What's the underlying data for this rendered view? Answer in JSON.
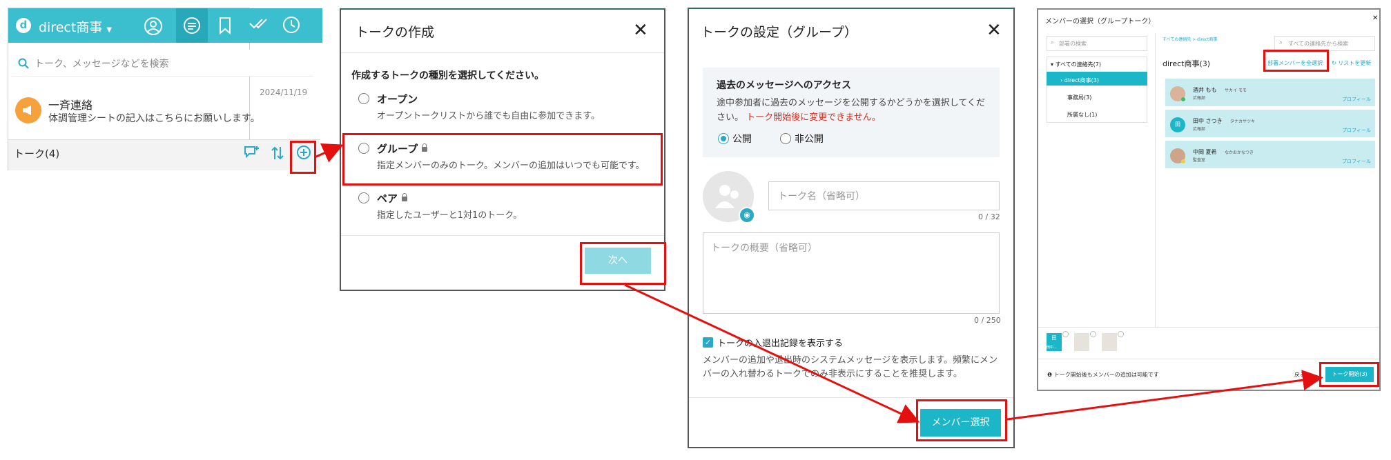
{
  "colors": {
    "brand": "#3bbfcf",
    "accent_button": "#1cb6c9",
    "highlight": "#e41010",
    "error_text": "#e0281a"
  },
  "panel1": {
    "app_name": "direct商事",
    "header_icons": [
      "user-circle-icon",
      "chat-icon",
      "bookmark-icon",
      "double-check-icon",
      "clock-icon"
    ],
    "search_placeholder": "トーク、メッセージなどを検索",
    "talk_item": {
      "title": "一斉連絡",
      "preview": "体調管理シートの記入はこちらにお願いします。",
      "date": "2024/11/19",
      "icon": "megaphone-icon"
    },
    "talk_count": "トーク(4)",
    "footer_icons": [
      "new-chat-icon",
      "sort-icon",
      "add-talk-icon"
    ]
  },
  "panel2": {
    "title": "トークの作成",
    "prompt": "作成するトークの種別を選択してください。",
    "options": [
      {
        "label": "オープン",
        "desc": "オープントークリストから誰でも自由に参加できます。"
      },
      {
        "label": "グループ",
        "desc": "指定メンバーのみのトーク。メンバーの追加はいつでも可能です。"
      },
      {
        "label": "ペア",
        "desc": "指定したユーザーと1対1のトーク。"
      }
    ],
    "next_button": "次へ"
  },
  "panel3": {
    "title": "トークの設定（グループ）",
    "access_title": "過去のメッセージへのアクセス",
    "access_desc_1": "途中参加者に過去のメッセージを公開するかどうかを選択してくだ",
    "access_desc_2": "さい。",
    "access_warning": "トーク開始後に変更できません。",
    "public_label": "公開",
    "private_label": "非公開",
    "name_placeholder": "トーク名（省略可）",
    "name_count": "0 / 32",
    "desc_placeholder": "トークの概要（省略可）",
    "desc_count": "0 / 250",
    "log_checkbox_label": "トークの入退出記録を表示する",
    "log_desc_1": "メンバーの追加や退出時のシステムメッセージを表示します。頻繁にメン",
    "log_desc_2": "バーの入れ替わるトークでのみ非表示にすることを推奨します。",
    "member_select_button": "メンバー選択"
  },
  "panel4": {
    "title": "メンバーの選択（グループトーク）",
    "dept_search_placeholder": "部署の検索",
    "tree": [
      {
        "label": "すべての連絡先(7)"
      },
      {
        "label": "direct商事(3)"
      },
      {
        "label": "事務局(3)"
      },
      {
        "label": "所属なし(1)"
      }
    ],
    "breadcrumb": "すべての連絡先 > direct商事",
    "contact_search_placeholder": "すべての連絡先から検索",
    "dept_name": "direct商事(3)",
    "select_all_link": "部署メンバーを全選択",
    "reload_link": "リストを更新",
    "members": [
      {
        "name": "酒井 もも",
        "kana": "サカイ モモ",
        "dept": "広報部",
        "profile": "プロフィール"
      },
      {
        "name": "田中 さつき",
        "kana": "タナカサツキ",
        "dept": "広報部",
        "profile": "プロフィール"
      },
      {
        "name": "中岡 夏希",
        "kana": "なかおかなつき",
        "dept": "監査室",
        "profile": "プロフィール"
      }
    ],
    "selected_first_name": "田中...",
    "footer_note": "トーク開始後もメンバーの追加は可能です",
    "back_link": "戻る",
    "start_button": "トーク開始(3)"
  }
}
